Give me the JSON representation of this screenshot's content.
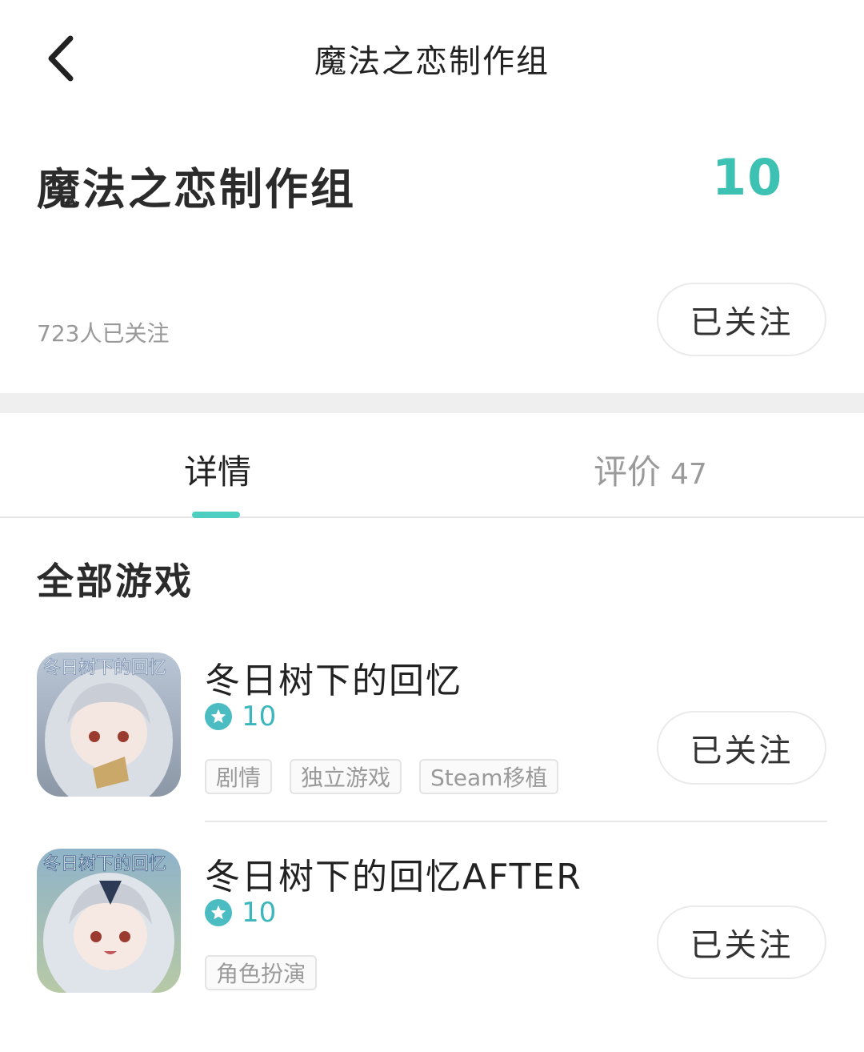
{
  "topbar": {
    "title": "魔法之恋制作组"
  },
  "developer": {
    "name": "魔法之恋制作组",
    "score": "10",
    "followers": "723人已关注",
    "follow_label": "已关注"
  },
  "tabs": [
    {
      "label": "详情",
      "active": true
    },
    {
      "label": "评价",
      "count": "47",
      "active": false
    }
  ],
  "section": {
    "title": "全部游戏"
  },
  "games": [
    {
      "name": "冬日树下的回忆",
      "rating": "10",
      "tags": [
        "剧情",
        "独立游戏",
        "Steam移植"
      ],
      "follow_label": "已关注",
      "icon_text": "冬日树下的回忆"
    },
    {
      "name": "冬日树下的回忆AFTER",
      "rating": "10",
      "tags": [
        "角色扮演"
      ],
      "follow_label": "已关注",
      "icon_text": "冬日树下的回忆"
    }
  ],
  "colors": {
    "accent": "#3cc1b2",
    "star": "#4bbcc2",
    "band": "#efefef"
  }
}
